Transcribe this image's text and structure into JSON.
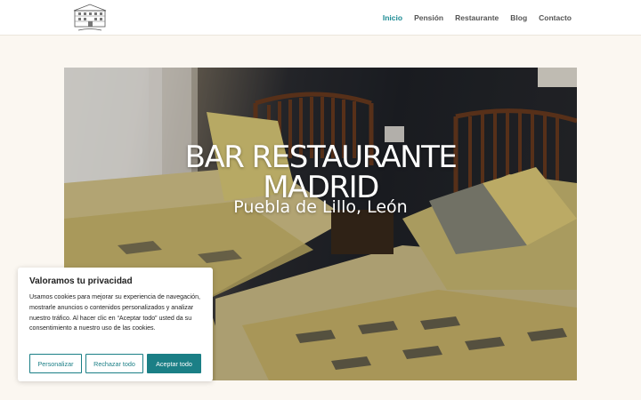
{
  "header": {
    "logo_icon": "restaurant-building-logo",
    "nav": [
      {
        "label": "Inicio",
        "active": true
      },
      {
        "label": "Pensión",
        "active": false
      },
      {
        "label": "Restaurante",
        "active": false
      },
      {
        "label": "Blog",
        "active": false
      },
      {
        "label": "Contacto",
        "active": false
      }
    ],
    "accent_color": "#1b8a93"
  },
  "hero": {
    "title_line1": "BAR RESTAURANTE",
    "title_line2": "MADRID",
    "subtitle": "Puebla de Lillo, León"
  },
  "cookie_banner": {
    "title": "Valoramos tu privacidad",
    "text": "Usamos cookies para mejorar su experiencia de navegación, mostrarle anuncios o contenidos personalizados y analizar nuestro tráfico. Al hacer clic en “Aceptar todo” usted da su consentimiento a nuestro uso de las cookies.",
    "buttons": {
      "customize": "Personalizar",
      "reject": "Rechazar todo",
      "accept": "Aceptar todo"
    },
    "button_color": "#1b7f86"
  }
}
